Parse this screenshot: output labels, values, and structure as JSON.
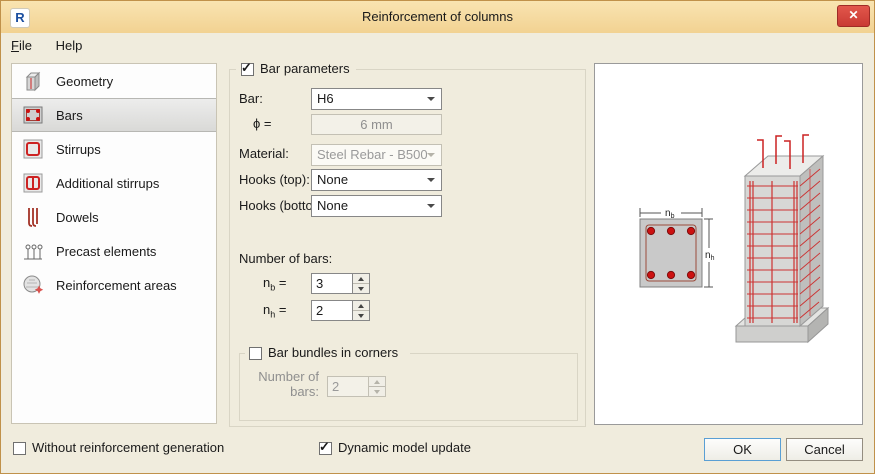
{
  "window": {
    "title": "Reinforcement of columns",
    "app_initial": "R",
    "close_glyph": "✕"
  },
  "menu": {
    "file": "File",
    "help": "Help"
  },
  "sidebar": {
    "items": [
      {
        "label": "Geometry"
      },
      {
        "label": "Bars"
      },
      {
        "label": "Stirrups"
      },
      {
        "label": "Additional stirrups"
      },
      {
        "label": "Dowels"
      },
      {
        "label": "Precast elements"
      },
      {
        "label": "Reinforcement areas"
      }
    ],
    "selected": "Bars"
  },
  "bar_parameters": {
    "group_label": "Bar parameters",
    "checked": true,
    "bar_label": "Bar:",
    "bar_value": "H6",
    "phi_label": "ϕ =",
    "phi_value": "6 mm",
    "material_label": "Material:",
    "material_value": "Steel Rebar - B500",
    "hooks_top_label": "Hooks (top):",
    "hooks_top_value": "None",
    "hooks_bottom_label": "Hooks (bottom):",
    "hooks_bottom_value": "None",
    "number_of_bars_label": "Number of bars:",
    "nb": {
      "base": "n",
      "sub": "b",
      "eq": "="
    },
    "nh": {
      "base": "n",
      "sub": "h",
      "eq": "="
    },
    "nb_value": "3",
    "nh_value": "2"
  },
  "bar_bundles": {
    "group_label": "Bar bundles in corners",
    "checked": false,
    "number_label": "Number of bars:",
    "value": "2"
  },
  "preview": {
    "dim_b": {
      "base": "n",
      "sub": "b"
    },
    "dim_h": {
      "base": "n",
      "sub": "h"
    }
  },
  "footer": {
    "without_label": "Without reinforcement generation",
    "without_checked": false,
    "dynamic_label": "Dynamic model update",
    "dynamic_checked": true,
    "ok_label": "OK",
    "cancel_label": "Cancel"
  },
  "colors": {
    "accent_red": "#cc2222",
    "titlebar": "#f5d79b",
    "selection_gray": "#dcdcda"
  }
}
